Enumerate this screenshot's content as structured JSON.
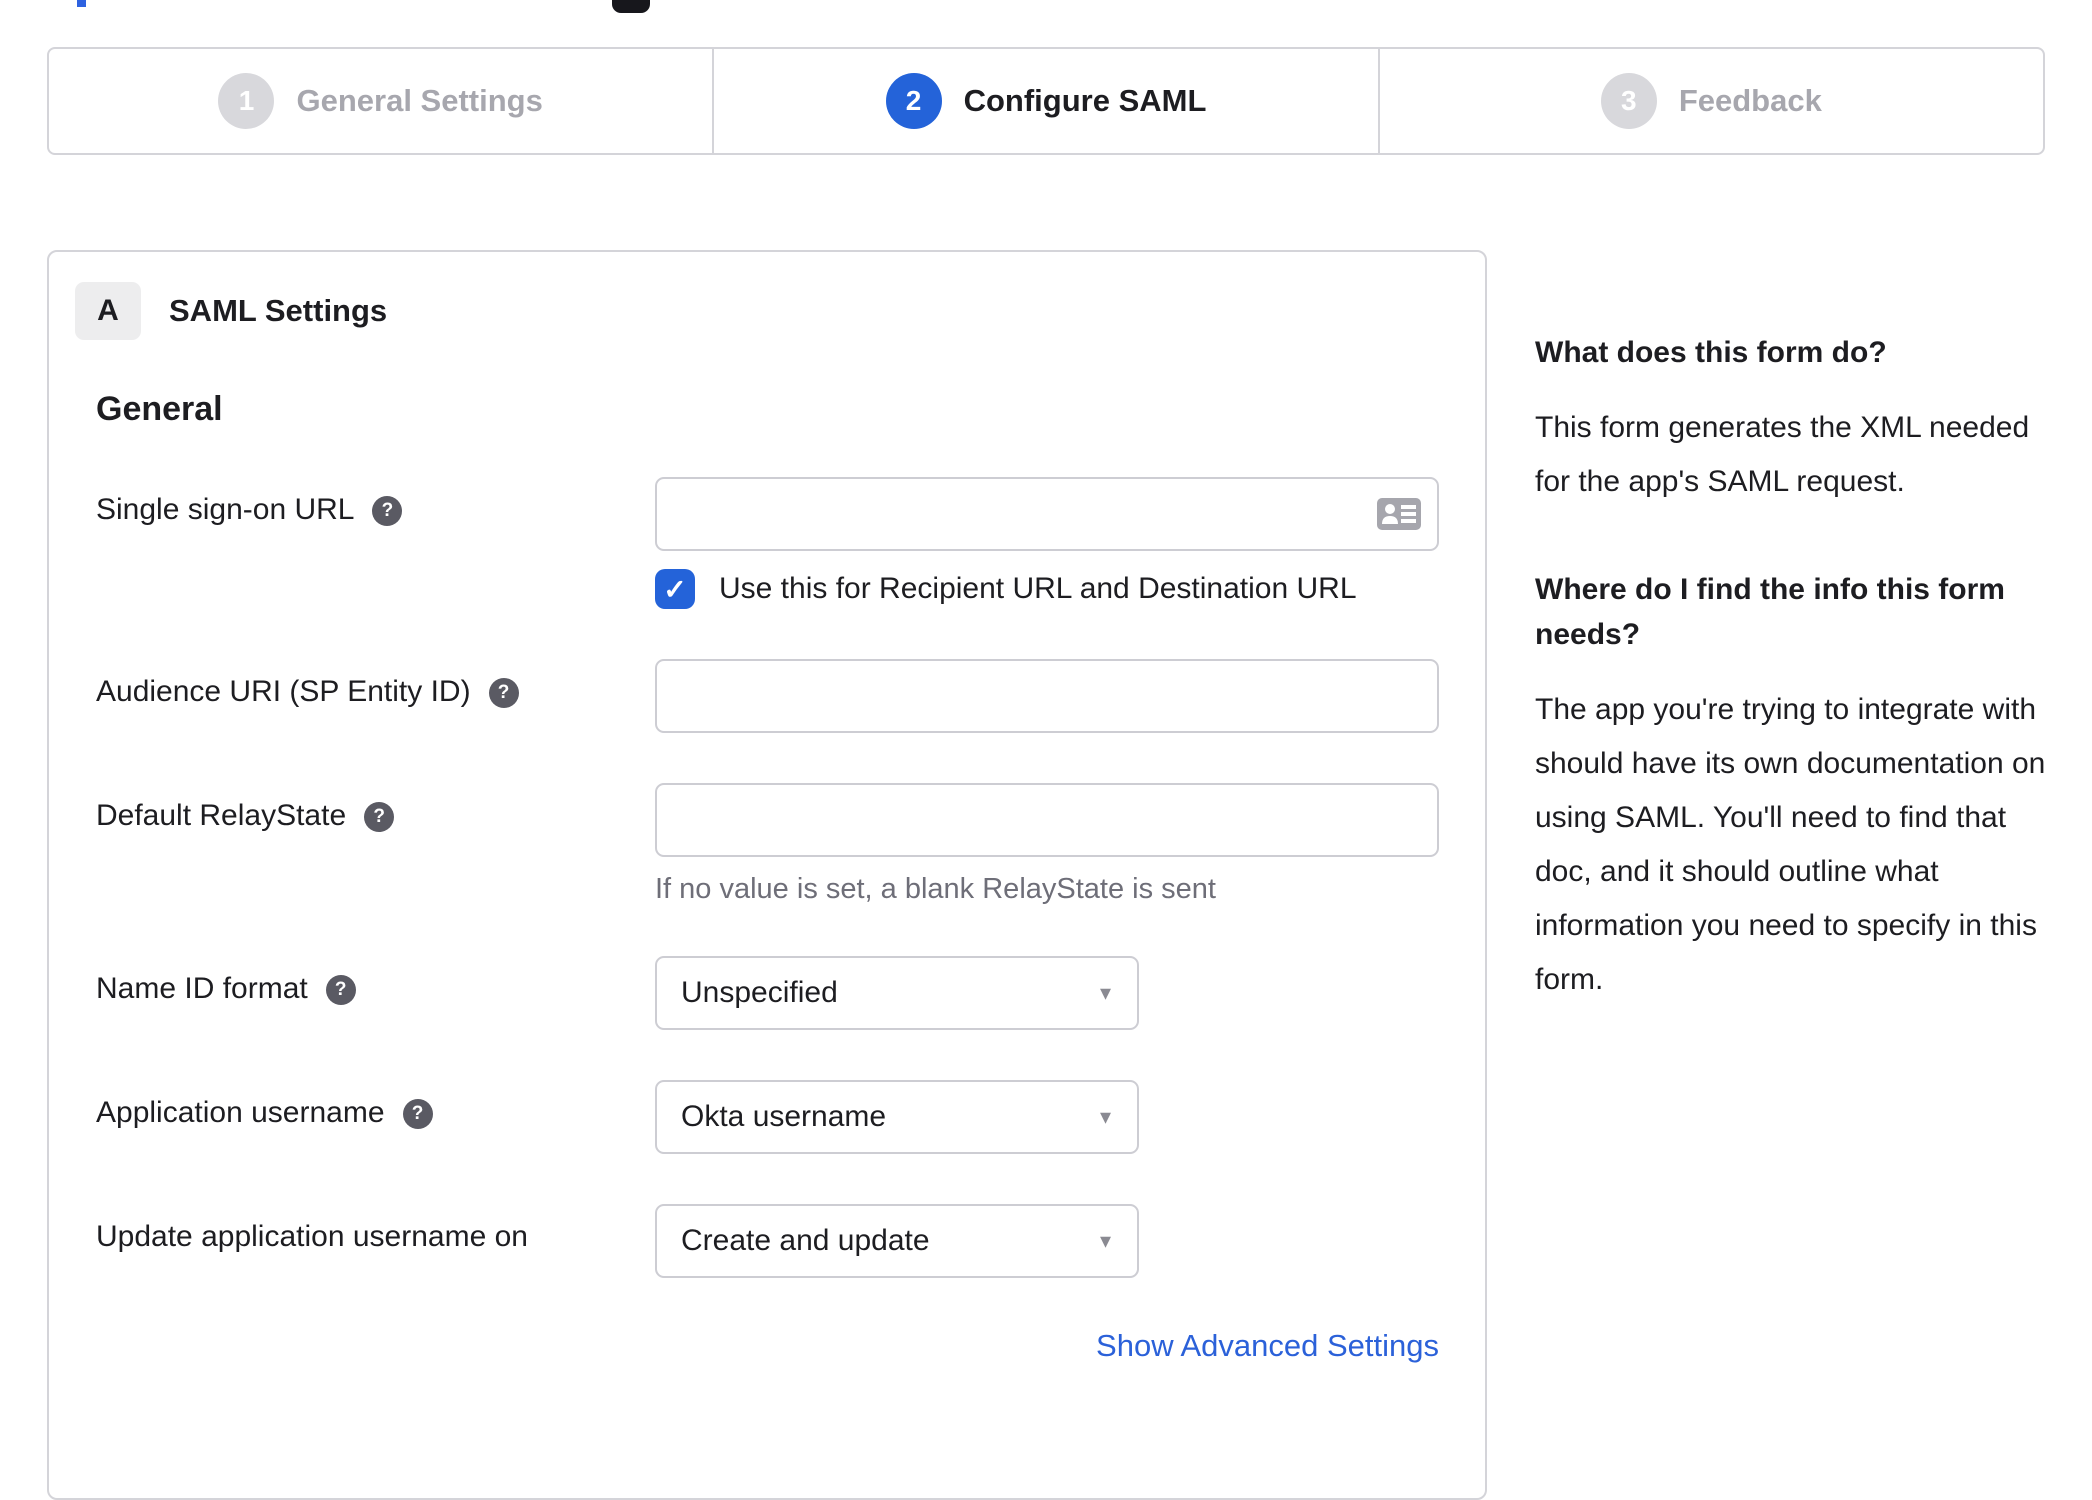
{
  "colors": {
    "accent": "#2463d9",
    "link": "#2b61d9",
    "text": "#1d1d21",
    "muted": "#6e6e78",
    "inactive-text": "#a7a7ae",
    "inactive-circle": "#d8d8dc",
    "border": "#d4d4d9",
    "input-border": "#cdcdd3",
    "badge-bg": "#ededee",
    "help-bg": "#5a5a63",
    "icon-gray": "#a6a6ad"
  },
  "icons": {
    "help_glyph": "?",
    "dropdown_glyph": "▾",
    "check_glyph": "✓"
  },
  "stepper": {
    "steps": [
      {
        "number": "1",
        "label": "General Settings",
        "state": "inactive"
      },
      {
        "number": "2",
        "label": "Configure SAML",
        "state": "active"
      },
      {
        "number": "3",
        "label": "Feedback",
        "state": "inactive"
      }
    ]
  },
  "panel": {
    "badge": "A",
    "title": "SAML Settings",
    "section_title": "General",
    "advanced_link": "Show Advanced Settings"
  },
  "form": {
    "fields": [
      {
        "label": "Single sign-on URL",
        "has_help": true,
        "type": "text",
        "value": "",
        "trailing_icon": "contact-card",
        "checkbox_checked": true,
        "checkbox_label": "Use this for Recipient URL and Destination URL"
      },
      {
        "label": "Audience URI (SP Entity ID)",
        "has_help": true,
        "type": "text",
        "value": ""
      },
      {
        "label": "Default RelayState",
        "has_help": true,
        "type": "text",
        "value": "",
        "helper": "If no value is set, a blank RelayState is sent"
      },
      {
        "label": "Name ID format",
        "has_help": true,
        "type": "select",
        "value": "Unspecified"
      },
      {
        "label": "Application username",
        "has_help": true,
        "type": "select",
        "value": "Okta username"
      },
      {
        "label": "Update application username on",
        "has_help": false,
        "type": "select",
        "value": "Create and update"
      }
    ]
  },
  "sidebar": {
    "sections": [
      {
        "heading": "What does this form do?",
        "body": "This form generates the XML needed for the app's SAML request."
      },
      {
        "heading": "Where do I find the info this form needs?",
        "body": "The app you're trying to integrate with should have its own documentation on using SAML. You'll need to find that doc, and it should outline what information you need to specify in this form."
      }
    ]
  }
}
